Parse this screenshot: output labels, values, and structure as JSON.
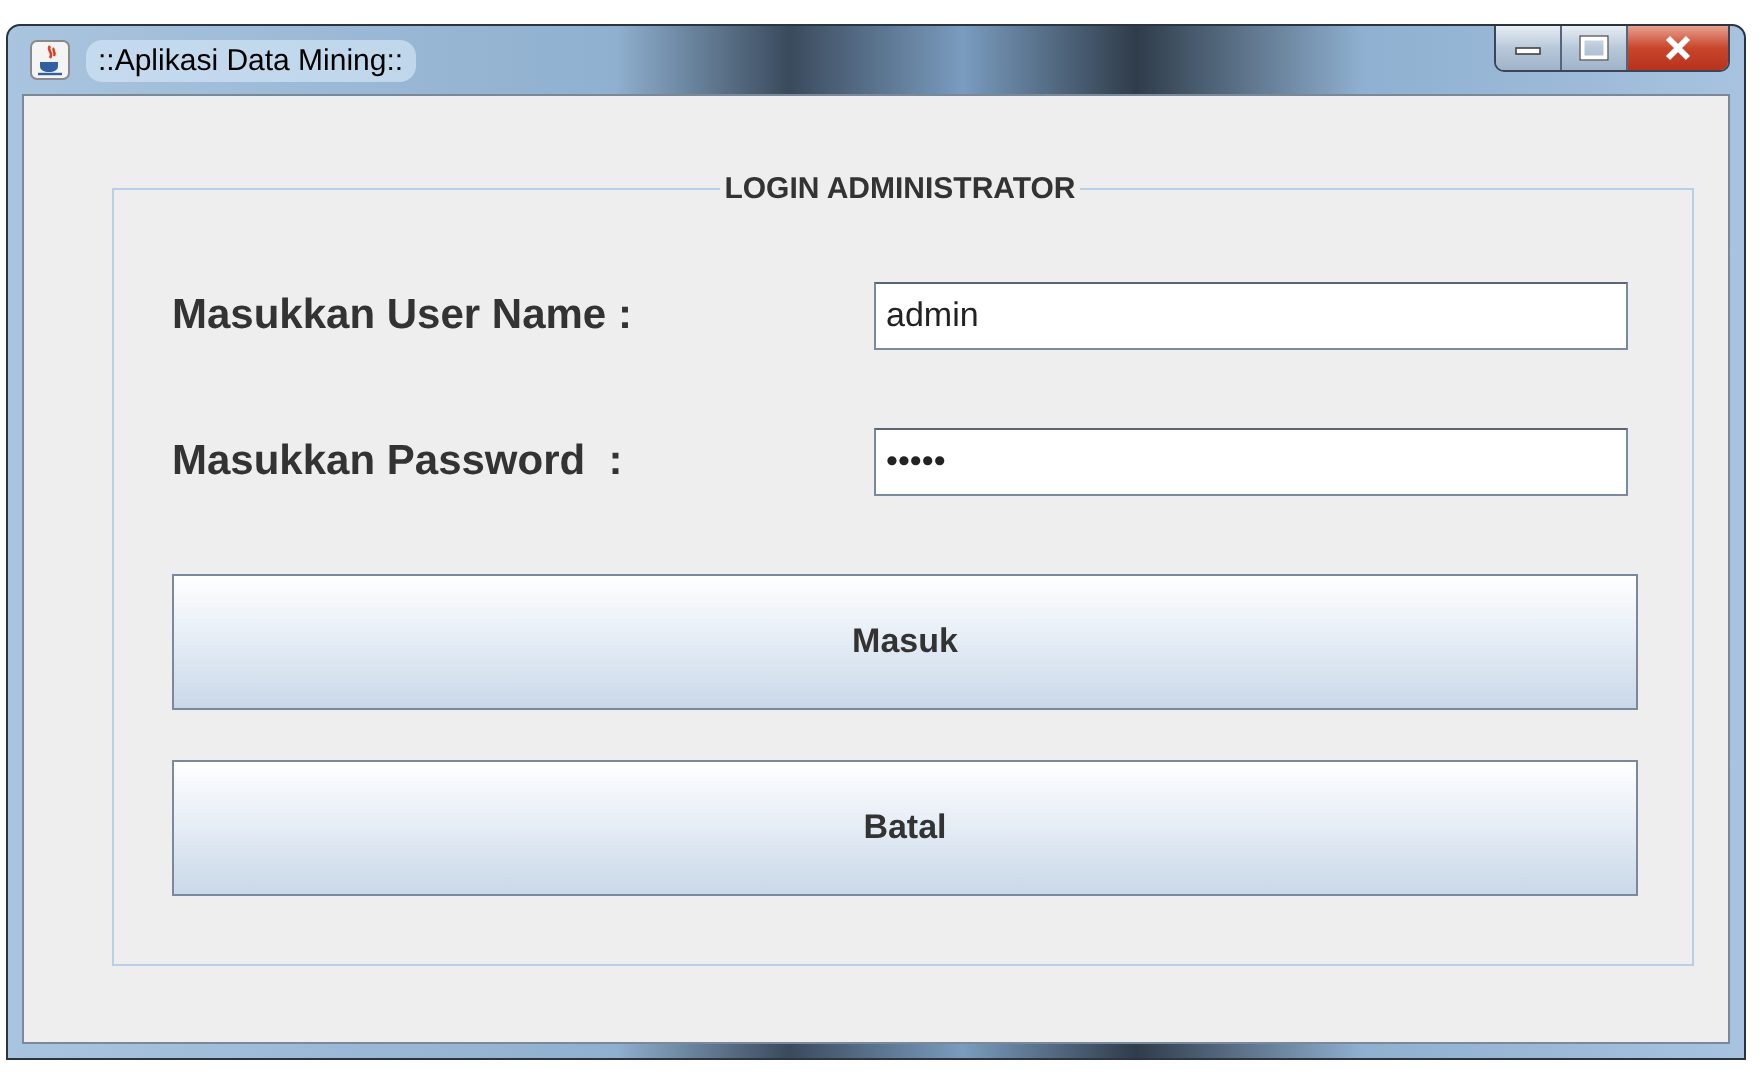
{
  "window": {
    "title": "::Aplikasi Data Mining::"
  },
  "panel": {
    "title": "LOGIN ADMINISTRATOR"
  },
  "fields": [
    {
      "label": "Masukkan User Name :",
      "value": "admin"
    },
    {
      "label": "Masukkan Password  :",
      "value": "•••••"
    }
  ],
  "buttons": [
    "Masuk",
    "Batal"
  ]
}
